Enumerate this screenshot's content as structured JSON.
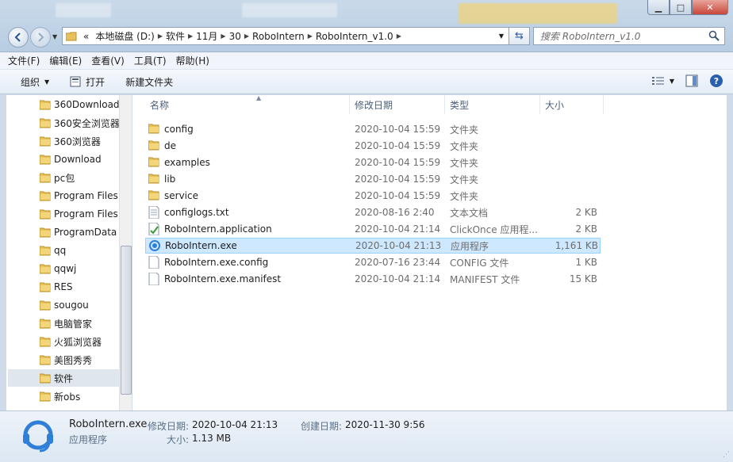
{
  "window": {
    "minimize_glyph": "▁",
    "maximize_glyph": "□",
    "close_glyph": "✕"
  },
  "address": {
    "overflow": "«",
    "segments": [
      "本地磁盘 (D:)",
      "软件",
      "11月",
      "30",
      "RoboIntern",
      "RoboIntern_v1.0"
    ],
    "search_placeholder": "搜索 RoboIntern_v1.0"
  },
  "menu": [
    "文件(F)",
    "编辑(E)",
    "查看(V)",
    "工具(T)",
    "帮助(H)"
  ],
  "toolbar": {
    "organize": "组织",
    "open": "打开",
    "new_folder": "新建文件夹"
  },
  "nav": {
    "items": [
      {
        "label": "360Download"
      },
      {
        "label": "360安全浏览器"
      },
      {
        "label": "360浏览器"
      },
      {
        "label": "Download"
      },
      {
        "label": "pc包"
      },
      {
        "label": "Program Files"
      },
      {
        "label": "Program Files"
      },
      {
        "label": "ProgramData"
      },
      {
        "label": "qq"
      },
      {
        "label": "qqwj"
      },
      {
        "label": "RES"
      },
      {
        "label": "sougou"
      },
      {
        "label": "电脑管家"
      },
      {
        "label": "火狐浏览器"
      },
      {
        "label": "美图秀秀"
      },
      {
        "label": "软件"
      },
      {
        "label": "新obs"
      }
    ],
    "selected_index": 15
  },
  "columns": {
    "name": "名称",
    "date": "修改日期",
    "type": "类型",
    "size": "大小"
  },
  "files": [
    {
      "name": "config",
      "date": "2020-10-04 15:59",
      "type": "文件夹",
      "size": "",
      "icon": "folder-icon"
    },
    {
      "name": "de",
      "date": "2020-10-04 15:59",
      "type": "文件夹",
      "size": "",
      "icon": "folder-icon"
    },
    {
      "name": "examples",
      "date": "2020-10-04 15:59",
      "type": "文件夹",
      "size": "",
      "icon": "folder-icon"
    },
    {
      "name": "lib",
      "date": "2020-10-04 15:59",
      "type": "文件夹",
      "size": "",
      "icon": "folder-icon"
    },
    {
      "name": "service",
      "date": "2020-10-04 15:59",
      "type": "文件夹",
      "size": "",
      "icon": "folder-icon"
    },
    {
      "name": "configlogs.txt",
      "date": "2020-08-16 2:40",
      "type": "文本文档",
      "size": "2 KB",
      "icon": "text-file-icon"
    },
    {
      "name": "RoboIntern.application",
      "date": "2020-10-04 21:14",
      "type": "ClickOnce 应用程...",
      "size": "2 KB",
      "icon": "clickonce-icon"
    },
    {
      "name": "RoboIntern.exe",
      "date": "2020-10-04 21:13",
      "type": "应用程序",
      "size": "1,161 KB",
      "icon": "app-icon"
    },
    {
      "name": "RoboIntern.exe.config",
      "date": "2020-07-16 23:44",
      "type": "CONFIG 文件",
      "size": "1 KB",
      "icon": "blank-file-icon"
    },
    {
      "name": "RoboIntern.exe.manifest",
      "date": "2020-10-04 21:14",
      "type": "MANIFEST 文件",
      "size": "15 KB",
      "icon": "blank-file-icon"
    }
  ],
  "selected_file_index": 7,
  "details": {
    "name": "RoboIntern.exe",
    "type": "应用程序",
    "modified_label": "修改日期:",
    "modified": "2020-10-04 21:13",
    "created_label": "创建日期:",
    "created": "2020-11-30 9:56",
    "size_label": "大小:",
    "size": "1.13 MB"
  },
  "colors": {
    "selection_bg": "#cde8ff",
    "selection_border": "#99d1ff",
    "folder": "#e8c15a",
    "app_icon": "#2f7fd8"
  }
}
